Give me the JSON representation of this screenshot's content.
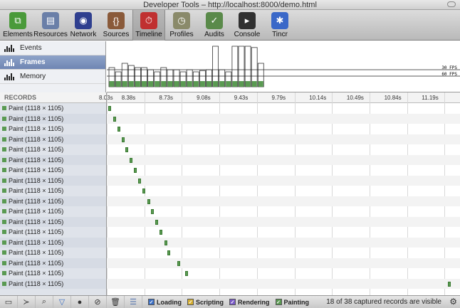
{
  "window": {
    "title": "Developer Tools – http://localhost:8000/demo.html"
  },
  "toolbar": {
    "tabs": [
      {
        "label": "Elements",
        "icon": "elements-icon",
        "color": "#4a9a3a"
      },
      {
        "label": "Resources",
        "icon": "resources-icon",
        "color": "#6a7fa8"
      },
      {
        "label": "Network",
        "icon": "network-icon",
        "color": "#2f3f8f"
      },
      {
        "label": "Sources",
        "icon": "sources-icon",
        "color": "#8a5a3a"
      },
      {
        "label": "Timeline",
        "icon": "timeline-icon",
        "color": "#c03030",
        "selected": true
      },
      {
        "label": "Profiles",
        "icon": "profiles-icon",
        "color": "#8a8a6a"
      },
      {
        "label": "Audits",
        "icon": "audits-icon",
        "color": "#5a8a4a"
      },
      {
        "label": "Console",
        "icon": "console-icon",
        "color": "#303030"
      },
      {
        "label": "Tincr",
        "icon": "tincr-icon",
        "color": "#3a68c8"
      }
    ]
  },
  "overview": {
    "items": [
      {
        "label": "Events",
        "icon": "events-icon"
      },
      {
        "label": "Frames",
        "icon": "frames-icon",
        "selected": true
      },
      {
        "label": "Memory",
        "icon": "memory-icon"
      }
    ],
    "fps_labels": [
      "30 FPS",
      "60 FPS"
    ],
    "frame_heights": [
      0.45,
      0.35,
      0.55,
      0.5,
      0.45,
      0.45,
      0.4,
      0.35,
      0.45,
      0.4,
      0.4,
      0.35,
      0.4,
      0.35,
      0.38,
      0.4,
      0.95,
      0.4,
      0.35,
      0.95,
      0.95,
      0.95,
      0.92,
      0.55
    ]
  },
  "records": {
    "header": "RECORDS",
    "time_ticks": [
      "8.03s",
      "8.38s",
      "8.73s",
      "9.08s",
      "9.43s",
      "9.79s",
      "10.14s",
      "10.49s",
      "10.84s",
      "11.19s"
    ],
    "rows": [
      {
        "label": "Paint (1118 × 1105)",
        "start": 0.005
      },
      {
        "label": "Paint (1118 × 1105)",
        "start": 0.018
      },
      {
        "label": "Paint (1118 × 1105)",
        "start": 0.031
      },
      {
        "label": "Paint (1118 × 1105)",
        "start": 0.044
      },
      {
        "label": "Paint (1118 × 1105)",
        "start": 0.054
      },
      {
        "label": "Paint (1118 × 1105)",
        "start": 0.066
      },
      {
        "label": "Paint (1118 × 1105)",
        "start": 0.079
      },
      {
        "label": "Paint (1118 × 1105)",
        "start": 0.092
      },
      {
        "label": "Paint (1118 × 1105)",
        "start": 0.104
      },
      {
        "label": "Paint (1118 × 1105)",
        "start": 0.117
      },
      {
        "label": "Paint (1118 × 1105)",
        "start": 0.129
      },
      {
        "label": "Paint (1118 × 1105)",
        "start": 0.141
      },
      {
        "label": "Paint (1118 × 1105)",
        "start": 0.154
      },
      {
        "label": "Paint (1118 × 1105)",
        "start": 0.167
      },
      {
        "label": "Paint (1118 × 1105)",
        "start": 0.177
      },
      {
        "label": "Paint (1118 × 1105)",
        "start": 0.204
      },
      {
        "label": "Paint (1118 × 1105)",
        "start": 0.227
      },
      {
        "label": "Paint (1118 × 1105)",
        "start": 0.991
      }
    ]
  },
  "statusbar": {
    "filters": [
      {
        "label": "Loading",
        "color": "#3b6fc4",
        "checked": true
      },
      {
        "label": "Scripting",
        "color": "#d8b030",
        "checked": true
      },
      {
        "label": "Rendering",
        "color": "#7a5ac8",
        "checked": true
      },
      {
        "label": "Painting",
        "color": "#5a9a52",
        "checked": true
      }
    ],
    "status": "18 of 38 captured records are visible"
  },
  "colors": {
    "paint": "#5a9a52",
    "frame_fill": "#5a9a52"
  }
}
